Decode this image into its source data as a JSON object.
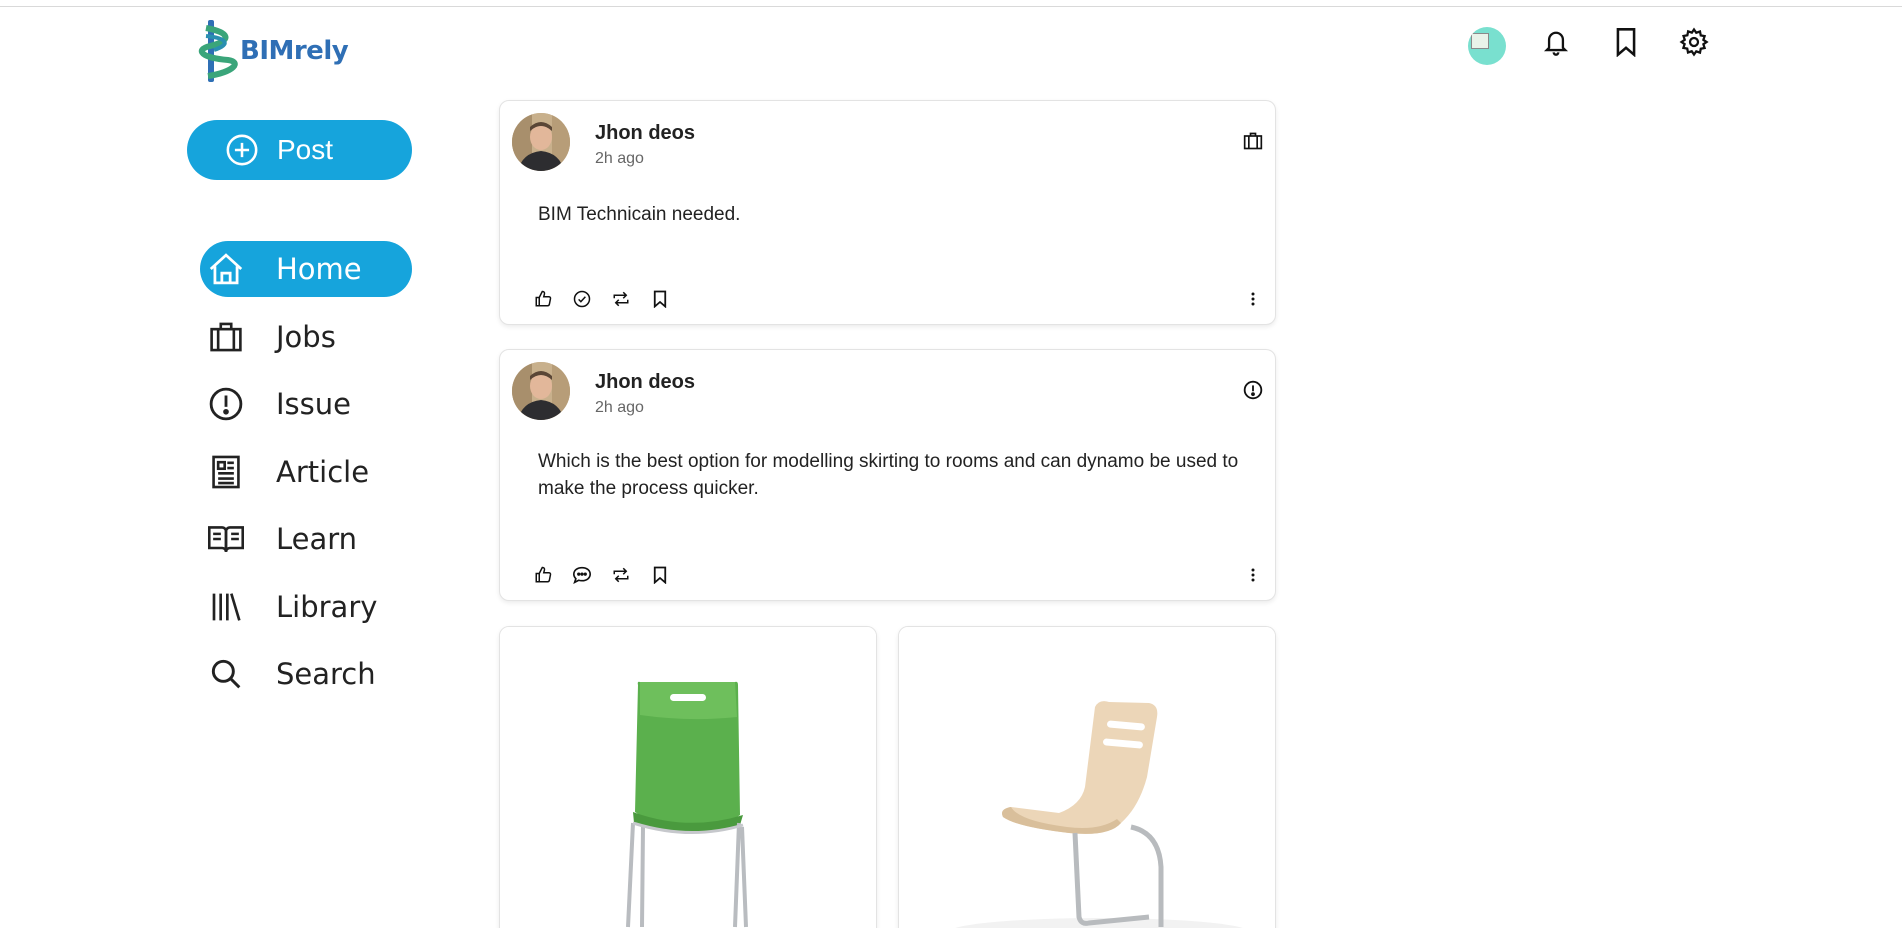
{
  "brand": {
    "name": "BIMrely"
  },
  "header": {
    "icons": [
      "avatar",
      "bell-icon",
      "bookmark-icon",
      "gear-icon"
    ]
  },
  "sidebar": {
    "post_label": "Post",
    "items": [
      {
        "label": "Home",
        "icon": "home-icon",
        "active": true
      },
      {
        "label": "Jobs",
        "icon": "briefcase-icon",
        "active": false
      },
      {
        "label": "Issue",
        "icon": "alert-circle-icon",
        "active": false
      },
      {
        "label": "Article",
        "icon": "article-icon",
        "active": false
      },
      {
        "label": "Learn",
        "icon": "open-book-icon",
        "active": false
      },
      {
        "label": "Library",
        "icon": "library-icon",
        "active": false
      },
      {
        "label": "Search",
        "icon": "search-icon",
        "active": false
      }
    ]
  },
  "feed": {
    "posts": [
      {
        "author": "Jhon deos",
        "time": "2h ago",
        "type_icon": "briefcase-icon",
        "text": "BIM Technicain needed.",
        "actions": [
          "like-icon",
          "check-circle-icon",
          "repost-icon",
          "bookmark-icon"
        ]
      },
      {
        "author": "Jhon deos",
        "time": "2h ago",
        "type_icon": "alert-circle-icon",
        "text": "Which is the best option for modelling skirting to rooms and can dynamo be used to make the process quicker.",
        "actions": [
          "like-icon",
          "comment-icon",
          "repost-icon",
          "bookmark-icon"
        ]
      }
    ],
    "images": [
      "green-chair-image",
      "wooden-chair-image"
    ]
  },
  "colors": {
    "accent": "#16a4dc",
    "logo_blue": "#2f6fb5",
    "logo_green": "#3aa57a"
  }
}
